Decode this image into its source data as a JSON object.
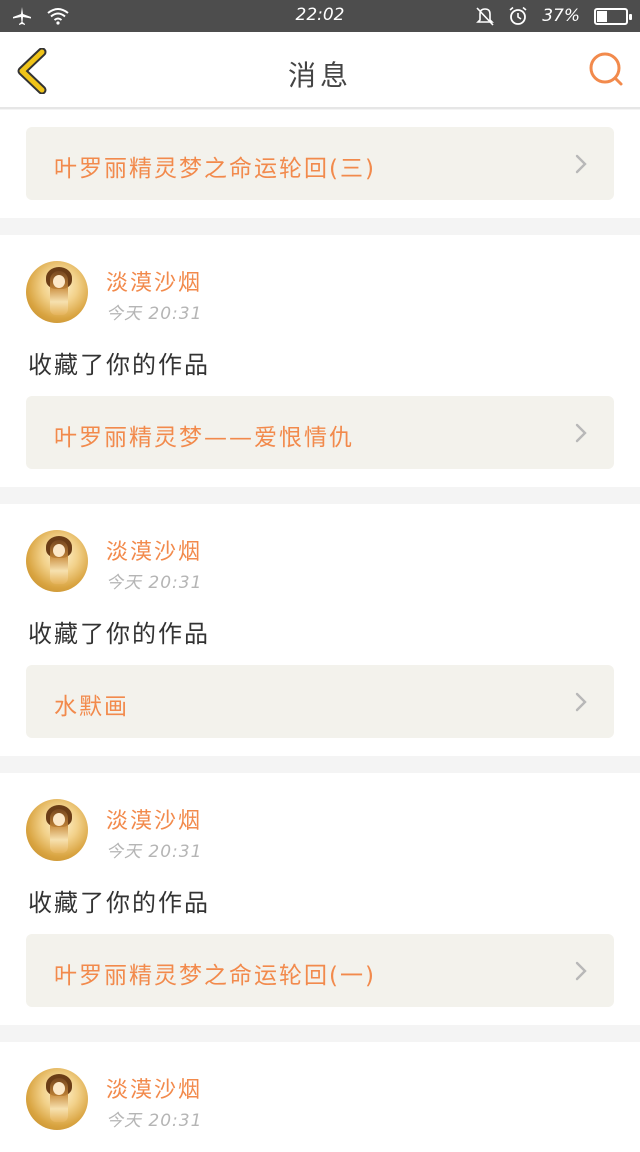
{
  "status_bar": {
    "time": "22:02",
    "battery_text": "37%",
    "battery_level": 0.37,
    "icons": [
      "airplane-icon",
      "wifi-icon",
      "bell-off-icon",
      "alarm-icon",
      "battery-icon"
    ]
  },
  "header": {
    "title": "消息",
    "back_icon": "chevron-left-icon",
    "search_icon": "search-icon"
  },
  "colors": {
    "accent": "#f28a4c",
    "back_icon": "#f0c419"
  },
  "feed": {
    "top_work_title": "叶罗丽精灵梦之命运轮回(三)",
    "items": [
      {
        "username": "淡漠沙烟",
        "time": "今天 20:31",
        "action": "收藏了你的作品",
        "work_title": "叶罗丽精灵梦——爱恨情仇"
      },
      {
        "username": "淡漠沙烟",
        "time": "今天 20:31",
        "action": "收藏了你的作品",
        "work_title": "水默画"
      },
      {
        "username": "淡漠沙烟",
        "time": "今天 20:31",
        "action": "收藏了你的作品",
        "work_title": "叶罗丽精灵梦之命运轮回(一)"
      },
      {
        "username": "淡漠沙烟",
        "time": "今天 20:31"
      }
    ]
  }
}
